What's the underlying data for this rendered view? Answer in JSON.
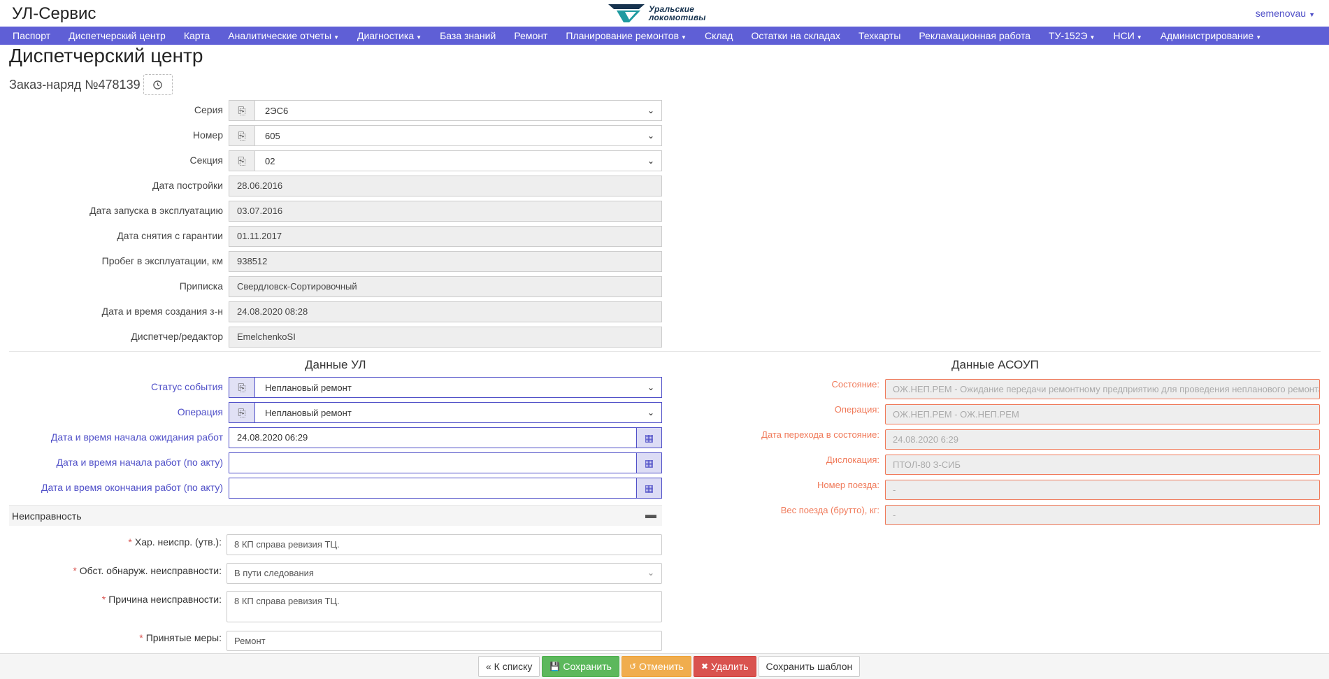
{
  "app": {
    "title": "УЛ-Сервис",
    "logo_line1": "Уральские",
    "logo_line2": "локомотивы",
    "user": "semenovau"
  },
  "nav": {
    "items": [
      {
        "label": "Паспорт"
      },
      {
        "label": "Диспетчерский центр"
      },
      {
        "label": "Карта"
      },
      {
        "label": "Аналитические отчеты",
        "dropdown": true
      },
      {
        "label": "Диагностика",
        "dropdown": true
      },
      {
        "label": "База знаний"
      },
      {
        "label": "Ремонт"
      },
      {
        "label": "Планирование ремонтов",
        "dropdown": true
      },
      {
        "label": "Склад"
      },
      {
        "label": "Остатки на складах"
      },
      {
        "label": "Техкарты"
      },
      {
        "label": "Рекламационная работа"
      },
      {
        "label": "ТУ-152Э",
        "dropdown": true
      },
      {
        "label": "НСИ",
        "dropdown": true
      },
      {
        "label": "Администрирование",
        "dropdown": true
      }
    ]
  },
  "page": {
    "title": "Диспетчерский центр",
    "order_title": "Заказ-наряд №478139"
  },
  "form": {
    "series": {
      "label": "Серия",
      "value": "2ЭС6"
    },
    "number": {
      "label": "Номер",
      "value": "605"
    },
    "section": {
      "label": "Секция",
      "value": "02"
    },
    "build_date": {
      "label": "Дата постройки",
      "value": "28.06.2016"
    },
    "commission_date": {
      "label": "Дата запуска в эксплуатацию",
      "value": "03.07.2016"
    },
    "warranty_end": {
      "label": "Дата снятия с гарантии",
      "value": "01.11.2017"
    },
    "mileage": {
      "label": "Пробег в эксплуатации, км",
      "value": "938512"
    },
    "depot": {
      "label": "Приписка",
      "value": "Свердловск-Сортировочный"
    },
    "created": {
      "label": "Дата и время создания з-н",
      "value": "24.08.2020 08:28"
    },
    "dispatcher": {
      "label": "Диспетчер/редактор",
      "value": "EmelchenkoSI"
    }
  },
  "ul_data": {
    "title": "Данные УЛ",
    "event_status": {
      "label": "Статус события",
      "value": "Неплановый ремонт"
    },
    "operation": {
      "label": "Операция",
      "value": "Неплановый ремонт"
    },
    "wait_start": {
      "label": "Дата и время начала ожидания работ",
      "value": "24.08.2020 06:29"
    },
    "work_start": {
      "label": "Дата и время начала работ (по акту)",
      "value": ""
    },
    "work_end": {
      "label": "Дата и время окончания работ (по акту)",
      "value": ""
    }
  },
  "asoup": {
    "title": "Данные АСОУП",
    "state": {
      "label": "Состояние:",
      "value": "ОЖ.НЕП.РЕМ - Ожидание передачи ремонтному предприятию для проведения непланового ремонта"
    },
    "operation": {
      "label": "Операция:",
      "value": "ОЖ.НЕП.РЕМ - ОЖ.НЕП.РЕМ"
    },
    "transition_date": {
      "label": "Дата перехода в состояние:",
      "value": "24.08.2020 6:29"
    },
    "location": {
      "label": "Дислокация:",
      "value": "ПТОЛ-80 З-СИБ"
    },
    "train_number": {
      "label": "Номер поезда:",
      "value": "-"
    },
    "train_weight": {
      "label": "Вес поезда (брутто), кг:",
      "value": "-"
    }
  },
  "fault": {
    "title": "Неисправность",
    "characteristic": {
      "label": "Хар. неиспр. (утв.):",
      "value": "8 КП справа ревизия ТЦ."
    },
    "circumstance": {
      "label": "Обст. обнаруж. неисправности:",
      "value": "В пути следования"
    },
    "cause": {
      "label": "Причина неисправности:",
      "value": "8 КП справа ревизия ТЦ."
    },
    "measures": {
      "label": "Принятые меры:",
      "value": "Ремонт"
    }
  },
  "actions": {
    "back": "« К списку",
    "save": "Сохранить",
    "cancel": "Отменить",
    "delete": "Удалить",
    "save_template": "Сохранить шаблон"
  },
  "colors": {
    "nav_bg": "#5f5fd6",
    "accent_blue": "#5050c8",
    "asoup_orange": "#f07a5a",
    "success": "#5cb85c",
    "warning": "#f0ad4e",
    "danger": "#d9534f"
  }
}
